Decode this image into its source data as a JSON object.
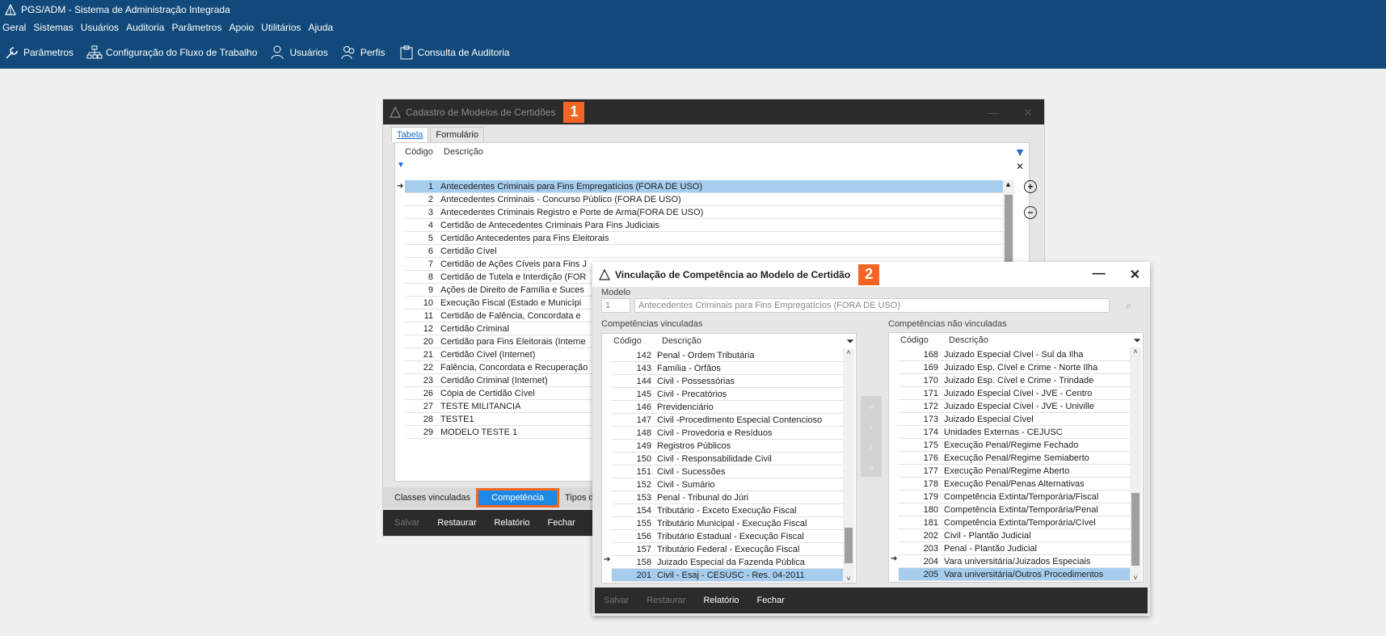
{
  "app": {
    "title": "PGS/ADM - Sistema de Administração Integrada"
  },
  "menu": [
    "Geral",
    "Sistemas",
    "Usuários",
    "Auditoria",
    "Parâmetros",
    "Apoio",
    "Utilitários",
    "Ajuda"
  ],
  "toolbar": {
    "params": "Parâmetros",
    "workflow": "Configuração do Fluxo de Trabalho",
    "users": "Usuários",
    "profiles": "Perfis",
    "audit": "Consulta de Auditoria"
  },
  "win1": {
    "title": "Cadastro de Modelos de Certidões",
    "badge": "1",
    "tabs": [
      "Tabela",
      "Formulário"
    ],
    "col_code": "Código",
    "col_desc": "Descrição",
    "rows": [
      {
        "code": "1",
        "desc": "Antecedentes Criminais para Fins Empregatícios (FORA DE USO)"
      },
      {
        "code": "2",
        "desc": "Antecedentes Criminais - Concurso Público (FORA DE USO)"
      },
      {
        "code": "3",
        "desc": "Antecedentes Criminais Registro e Porte de Arma(FORA DE USO)"
      },
      {
        "code": "4",
        "desc": "Certidão de Antecedentes Criminais Para Fins Judiciais"
      },
      {
        "code": "5",
        "desc": "Certidão Antecedentes para Fins Eleitorais"
      },
      {
        "code": "6",
        "desc": "Certidão Cível"
      },
      {
        "code": "7",
        "desc": "Certidão de Ações Cíveis para Fins J"
      },
      {
        "code": "8",
        "desc": "Certidão de Tutela e Interdição (FOR"
      },
      {
        "code": "9",
        "desc": "Ações de Direito de Família e Suces"
      },
      {
        "code": "10",
        "desc": "Execução Fiscal (Estado e Municípi"
      },
      {
        "code": "11",
        "desc": "Certidão de Falência, Concordata e"
      },
      {
        "code": "12",
        "desc": "Certidão Criminal"
      },
      {
        "code": "20",
        "desc": "Certidão para Fins Eleitorais (Interne"
      },
      {
        "code": "21",
        "desc": "Certidão Cível (Internet)"
      },
      {
        "code": "22",
        "desc": "Falência, Concordata e Recuperação"
      },
      {
        "code": "23",
        "desc": "Certidão Criminal (Internet)"
      },
      {
        "code": "26",
        "desc": "Cópia de Certidão Cível"
      },
      {
        "code": "27",
        "desc": "TESTE MILITANCIA"
      },
      {
        "code": "28",
        "desc": "TESTE1"
      },
      {
        "code": "29",
        "desc": "MODELO TESTE 1"
      }
    ],
    "bottom_tabs": {
      "classes": "Classes vinculadas",
      "competencia": "Competência",
      "tipos": "Tipos d"
    },
    "footer": {
      "save": "Salvar",
      "restore": "Restaurar",
      "report": "Relatório",
      "close": "Fechar"
    }
  },
  "win2": {
    "title": "Vinculação de Competência ao Modelo de Certidão",
    "badge": "2",
    "model_label": "Modelo",
    "model_code": "1",
    "model_desc": "Antecedentes Criminais para Fins Empregatícios (FORA DE USO)",
    "left_title": "Competências vinculadas",
    "right_title": "Competências não vinculadas",
    "col_code": "Código",
    "col_desc": "Descrição",
    "left_rows": [
      {
        "code": "142",
        "desc": "Penal - Ordem Tributária"
      },
      {
        "code": "143",
        "desc": "Família - Órfãos"
      },
      {
        "code": "144",
        "desc": "Civil - Possessórias"
      },
      {
        "code": "145",
        "desc": "Civil - Precatórios"
      },
      {
        "code": "146",
        "desc": "Previdenciário"
      },
      {
        "code": "147",
        "desc": "Civil -Procedimento Especial Contencioso"
      },
      {
        "code": "148",
        "desc": "Civil - Provedoria e Resíduos"
      },
      {
        "code": "149",
        "desc": "Registros Públicos"
      },
      {
        "code": "150",
        "desc": "Civil - Responsabilidade Civil"
      },
      {
        "code": "151",
        "desc": "Civil - Sucessões"
      },
      {
        "code": "152",
        "desc": "Civil - Sumário"
      },
      {
        "code": "153",
        "desc": "Penal - Tribunal do Júri"
      },
      {
        "code": "154",
        "desc": "Tributário - Exceto Execução Fiscal"
      },
      {
        "code": "155",
        "desc": "Tributário Municipal - Execução Fiscal"
      },
      {
        "code": "156",
        "desc": "Tributário Estadual - Execução Fiscal"
      },
      {
        "code": "157",
        "desc": "Tributário Federal - Execução Fiscal"
      },
      {
        "code": "158",
        "desc": "Juizado Especial da Fazenda Pública"
      },
      {
        "code": "201",
        "desc": "Civil - Esaj - CESUSC - Res. 04-2011"
      }
    ],
    "right_rows": [
      {
        "code": "168",
        "desc": "Juizado Especial Cível - Sul da Ilha"
      },
      {
        "code": "169",
        "desc": "Juizado Esp. Cível e Crime - Norte Ilha"
      },
      {
        "code": "170",
        "desc": "Juizado Esp. Cível e Crime - Trindade"
      },
      {
        "code": "171",
        "desc": "Juizado Especial Cível - JVE - Centro"
      },
      {
        "code": "172",
        "desc": "Juizado Especial Cível - JVE - Univille"
      },
      {
        "code": "173",
        "desc": "Juizado Especial Cível"
      },
      {
        "code": "174",
        "desc": "Unidades Externas - CEJUSC"
      },
      {
        "code": "175",
        "desc": "Execução Penal/Regime Fechado"
      },
      {
        "code": "176",
        "desc": "Execução Penal/Regime Semiaberto"
      },
      {
        "code": "177",
        "desc": "Execução Penal/Regime Aberto"
      },
      {
        "code": "178",
        "desc": "Execução Penal/Penas Alternativas"
      },
      {
        "code": "179",
        "desc": "Competência Extinta/Temporária/Fiscal"
      },
      {
        "code": "180",
        "desc": "Competência Extinta/Temporária/Penal"
      },
      {
        "code": "181",
        "desc": "Competência Extinta/Temporária/Cível"
      },
      {
        "code": "202",
        "desc": "Civil - Plantão Judicial"
      },
      {
        "code": "203",
        "desc": "Penal - Plantão Judicial"
      },
      {
        "code": "204",
        "desc": "Vara universitária/Juizados Especiais"
      },
      {
        "code": "205",
        "desc": "Vara universitária/Outros Procedimentos"
      }
    ],
    "footer": {
      "save": "Salvar",
      "restore": "Restaurar",
      "report": "Relatório",
      "close": "Fechar"
    }
  },
  "colors": {
    "header_blue": "#11497a",
    "accent_orange": "#f26522",
    "selection": "#a6cdee",
    "dark_bar": "#2b2b2b"
  }
}
